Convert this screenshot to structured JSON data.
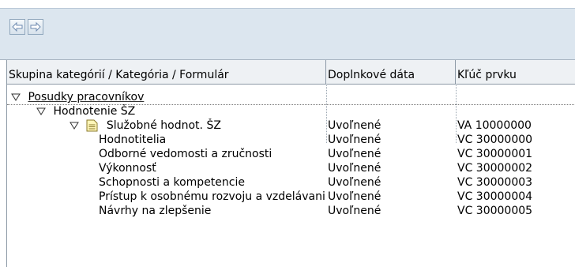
{
  "app": {
    "title": ""
  },
  "toolbar": {
    "back_icon": "arrow-left-icon",
    "forward_icon": "arrow-right-icon"
  },
  "table": {
    "columns": [
      "Skupina kategórií / Kategória / Formulár",
      "Doplnkové dáta",
      "Kľúč prvku"
    ],
    "rows": [
      {
        "label": "Posudky pracovníkov",
        "extra": "",
        "key": ""
      },
      {
        "label": "Hodnotenie ŠZ",
        "extra": "",
        "key": ""
      },
      {
        "label": "Služobné hodnot. ŠZ",
        "extra": "Uvoľnené",
        "key": "VA 10000000"
      },
      {
        "label": "Hodnotitelia",
        "extra": "Uvoľnené",
        "key": "VC 30000000"
      },
      {
        "label": "Odborné vedomosti a zručnosti",
        "extra": "Uvoľnené",
        "key": "VC 30000001"
      },
      {
        "label": "Výkonnosť",
        "extra": "Uvoľnené",
        "key": "VC 30000002"
      },
      {
        "label": "Schopnosti a kompetencie",
        "extra": "Uvoľnené",
        "key": "VC 30000003"
      },
      {
        "label": "Prístup k osobnému rozvoju a vzdelávaniu",
        "extra": "Uvoľnené",
        "key": "VC 30000004"
      },
      {
        "label": "Návrhy na zlepšenie",
        "extra": "Uvoľnené",
        "key": "VC 30000005"
      }
    ]
  }
}
